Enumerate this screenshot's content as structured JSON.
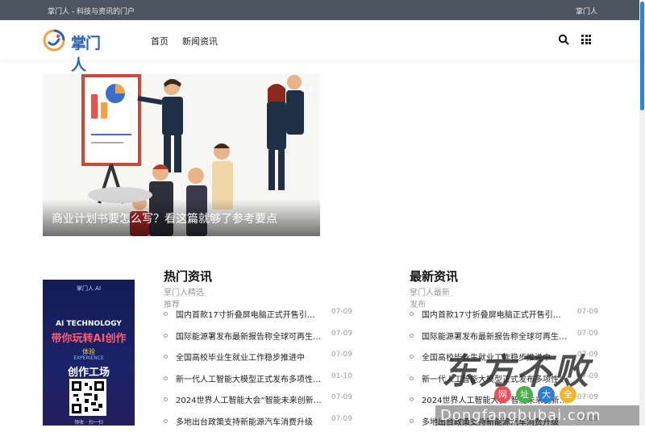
{
  "topbar": {
    "left_text": "掌门人 - 科技与资讯的门户",
    "right_text": "掌门人"
  },
  "nav": {
    "logo_text": "掌门人",
    "links": [
      "首页",
      "新闻资讯"
    ]
  },
  "hero": {
    "caption": "商业计划书要怎么写？看这篇就够了参考要点",
    "slides": 2
  },
  "poster": {
    "brand": "掌门人 AI",
    "line1": "AI TECHNOLOGY",
    "line2": "带你玩转AI创作",
    "line3": "体验",
    "line4": "EXPERIENCE",
    "line5": "创作工场",
    "line6": "领收 · 扫一扫"
  },
  "columns": [
    {
      "title": "热门资讯",
      "subtitle": "掌门人精选推荐",
      "items": [
        {
          "title": "国内首款17寸折叠屏电脑正式开售引热议",
          "date": "07-09"
        },
        {
          "title": "国际能源署发布最新报告称全球可再生能源装机量持续增长",
          "date": "07-09"
        },
        {
          "title": "全国高校毕业生就业工作稳步推进中",
          "date": "07-09"
        },
        {
          "title": "新一代人工智能大模型正式发布多项性能指标领先行业",
          "date": "01-10"
        },
        {
          "title": "2024世界人工智能大会“智能未来创新”在“智联天下”主题下开幕",
          "date": "07-09"
        },
        {
          "title": "多地出台政策支持新能源汽车消费升级",
          "date": "07-09"
        }
      ]
    },
    {
      "title": "最新资讯",
      "subtitle": "掌门人最新发布",
      "items": [
        {
          "title": "国内首款17寸折叠屏电脑正式开售引热议",
          "date": "07-09"
        },
        {
          "title": "国际能源署发布最新报告称全球可再生能源装机量持续增长",
          "date": "07-09"
        },
        {
          "title": "全国高校毕业生就业工作稳步推进中",
          "date": "07-09"
        },
        {
          "title": "新一代人工智能大模型正式发布多项性能指标领先行业",
          "date": "07-09"
        },
        {
          "title": "2024世界人工智能大会“智能未来创新”在“智联天下”主题下开幕",
          "date": "07-09"
        },
        {
          "title": "多地出台政策支持新能源汽车消费升级",
          "date": "07-09"
        }
      ]
    }
  ],
  "watermark": {
    "big": "东方不败",
    "chars": [
      "网",
      "址",
      "大",
      "全"
    ],
    "url": "Dongfangbubai.com",
    "circle_colors": [
      "#e9525b",
      "#4cae4c",
      "#2f7fd1",
      "#f1b52b"
    ]
  },
  "colors": {
    "topbar": "#4d5660",
    "accent": "#2a63b8",
    "scroll": "#3b82c4"
  }
}
